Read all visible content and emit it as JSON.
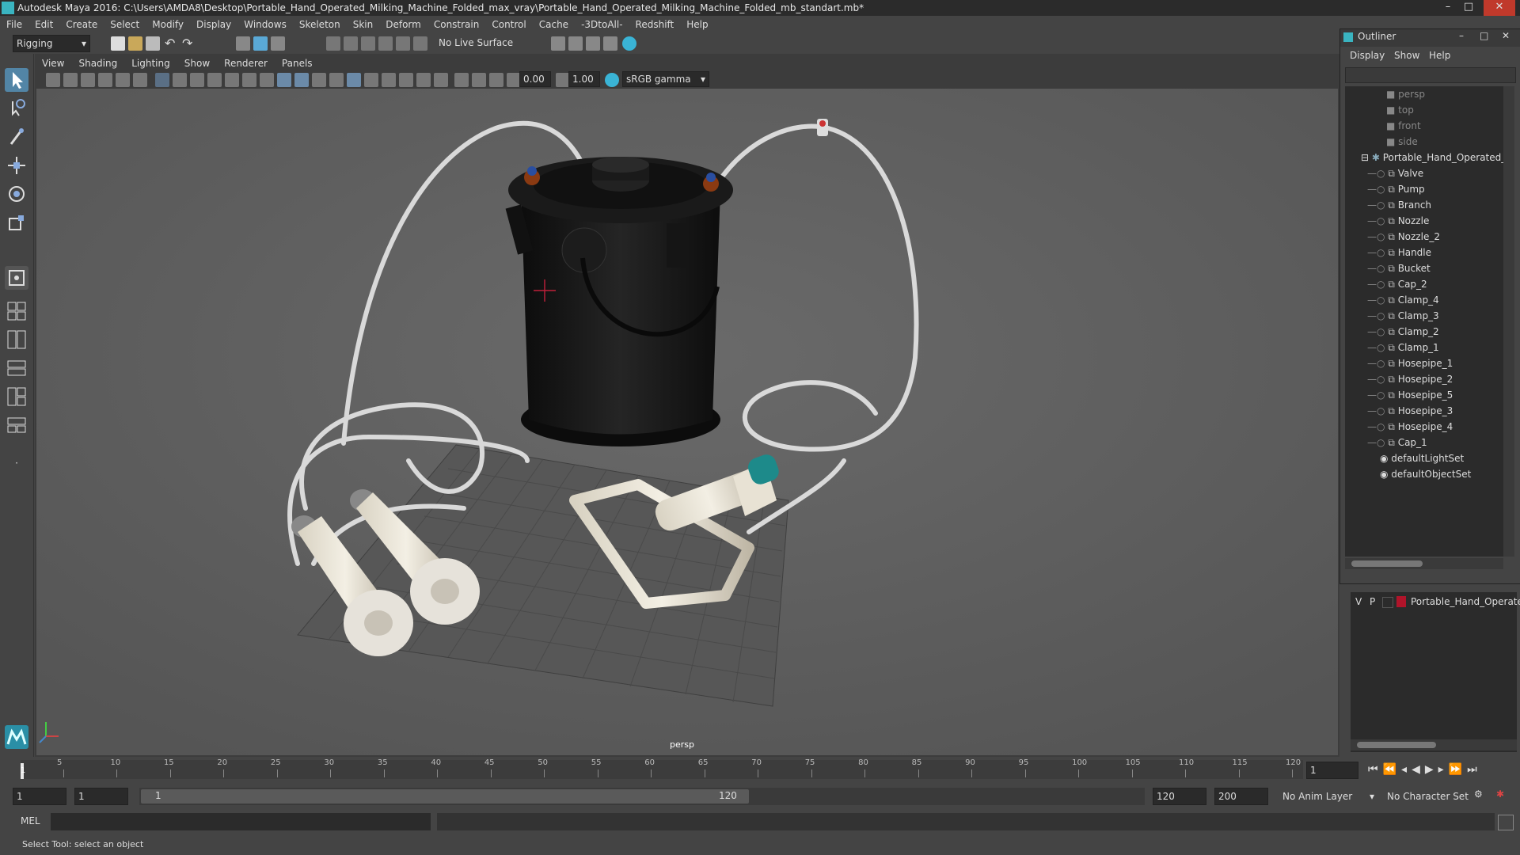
{
  "window": {
    "title": "Autodesk Maya 2016: C:\\Users\\AMDA8\\Desktop\\Portable_Hand_Operated_Milking_Machine_Folded_max_vray\\Portable_Hand_Operated_Milking_Machine_Folded_mb_standart.mb*",
    "controls": [
      "–",
      "□",
      "✕"
    ]
  },
  "menubar": [
    "File",
    "Edit",
    "Create",
    "Select",
    "Modify",
    "Display",
    "Windows",
    "Skeleton",
    "Skin",
    "Deform",
    "Constrain",
    "Control",
    "Cache",
    "-3DtoAll-",
    "Redshift",
    "Help"
  ],
  "shelf": {
    "mode": "Rigging",
    "live_surface": "No Live Surface"
  },
  "viewport": {
    "menu": [
      "View",
      "Shading",
      "Lighting",
      "Show",
      "Renderer",
      "Panels"
    ],
    "exposure": "0.00",
    "gamma": "1.00",
    "colorspace": "sRGB gamma",
    "camera_label": "persp"
  },
  "outliner": {
    "title": "Outliner",
    "menu": [
      "Display",
      "Show",
      "Help"
    ],
    "cameras": [
      "persp",
      "top",
      "front",
      "side"
    ],
    "root": "Portable_Hand_Operated_",
    "children": [
      "Valve",
      "Pump",
      "Branch",
      "Nozzle",
      "Nozzle_2",
      "Handle",
      "Bucket",
      "Cap_2",
      "Clamp_4",
      "Clamp_3",
      "Clamp_2",
      "Clamp_1",
      "Hosepipe_1",
      "Hosepipe_2",
      "Hosepipe_5",
      "Hosepipe_3",
      "Hosepipe_4",
      "Cap_1"
    ],
    "sets": [
      "defaultLightSet",
      "defaultObjectSet"
    ]
  },
  "layer": {
    "v": "V",
    "p": "P",
    "name": "Portable_Hand_Operate",
    "color": "#b0142a"
  },
  "timeline": {
    "ticks": [
      "5",
      "10",
      "15",
      "20",
      "25",
      "30",
      "35",
      "40",
      "45",
      "50",
      "55",
      "60",
      "65",
      "70",
      "75",
      "80",
      "85",
      "90",
      "95",
      "100",
      "105",
      "110",
      "115",
      "120"
    ],
    "start_marker": "1",
    "current_frame": "1"
  },
  "range": {
    "start": "1",
    "inner_start": "1",
    "slider_start": "1",
    "slider_end": "120",
    "end": "120",
    "outer_end": "200",
    "anim_layer": "No Anim Layer",
    "char_set": "No Character Set"
  },
  "command": {
    "lang": "MEL"
  },
  "helpline": "Select Tool: select an object"
}
